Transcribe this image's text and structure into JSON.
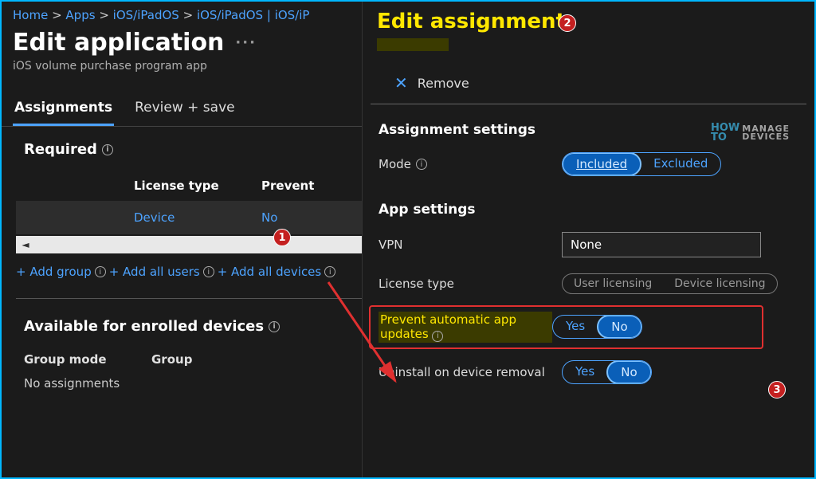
{
  "breadcrumb": {
    "home": "Home",
    "apps": "Apps",
    "platform": "iOS/iPadOS",
    "app": "iOS/iPadOS | iOS/iP"
  },
  "page": {
    "title": "Edit application",
    "subtitle": "iOS volume purchase program app"
  },
  "tabs": {
    "assignments": "Assignments",
    "review": "Review + save"
  },
  "required": {
    "heading": "Required",
    "col_license": "License type",
    "col_prevent": "Prevent",
    "row_license": "Device",
    "row_prevent": "No"
  },
  "add": {
    "group": "+ Add group",
    "users": "+ Add all users",
    "devices": "+ Add all devices"
  },
  "available": {
    "heading": "Available for enrolled devices",
    "col_mode": "Group mode",
    "col_group": "Group",
    "none": "No assignments"
  },
  "panel": {
    "title": "Edit assignment",
    "remove": "Remove",
    "section_assign": "Assignment settings",
    "mode_label": "Mode",
    "mode_included": "Included",
    "mode_excluded": "Excluded",
    "section_app": "App settings",
    "vpn_label": "VPN",
    "vpn_value": "None",
    "license_label": "License type",
    "license_user": "User licensing",
    "license_device": "Device licensing",
    "prevent_label": "Prevent automatic app updates",
    "uninstall_label": "Uninstall on device removal",
    "yes": "Yes",
    "no": "No"
  },
  "badges": {
    "one": "1",
    "two": "2",
    "three": "3"
  },
  "watermark": {
    "a": "HOW\nTO",
    "b": "MANAGE\nDEVICES"
  }
}
